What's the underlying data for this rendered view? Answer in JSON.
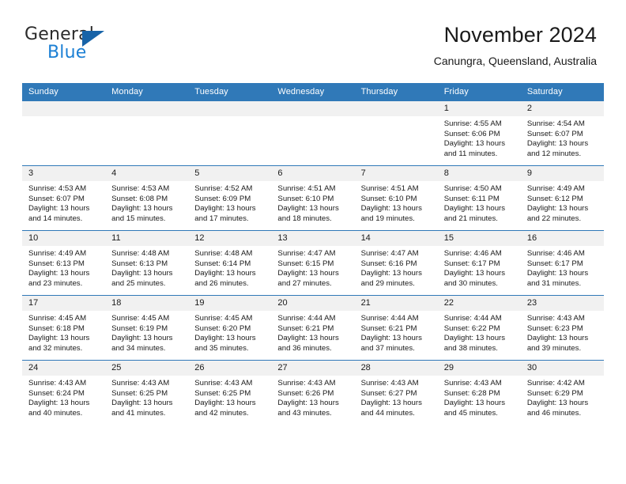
{
  "brand": {
    "name_top": "General",
    "name_bottom": "Blue",
    "triangle_color": "#1763a8",
    "blue_color": "#1b7fd4"
  },
  "header": {
    "title": "November 2024",
    "subtitle": "Canungra, Queensland, Australia"
  },
  "theme": {
    "header_blue": "#3079b8",
    "daynum_gray": "#f1f1f1",
    "text": "#1a1a1a"
  },
  "labels": {
    "sunrise_prefix": "Sunrise:",
    "sunset_prefix": "Sunset:",
    "daylight_prefix": "Daylight:"
  },
  "weekdays": [
    "Sunday",
    "Monday",
    "Tuesday",
    "Wednesday",
    "Thursday",
    "Friday",
    "Saturday"
  ],
  "weeks": [
    [
      {
        "day": "",
        "blank": true
      },
      {
        "day": "",
        "blank": true
      },
      {
        "day": "",
        "blank": true
      },
      {
        "day": "",
        "blank": true
      },
      {
        "day": "",
        "blank": true
      },
      {
        "day": "1",
        "sunrise": "Sunrise: 4:55 AM",
        "sunset": "Sunset: 6:06 PM",
        "daylight1": "Daylight: 13 hours",
        "daylight2": "and 11 minutes."
      },
      {
        "day": "2",
        "sunrise": "Sunrise: 4:54 AM",
        "sunset": "Sunset: 6:07 PM",
        "daylight1": "Daylight: 13 hours",
        "daylight2": "and 12 minutes."
      }
    ],
    [
      {
        "day": "3",
        "sunrise": "Sunrise: 4:53 AM",
        "sunset": "Sunset: 6:07 PM",
        "daylight1": "Daylight: 13 hours",
        "daylight2": "and 14 minutes."
      },
      {
        "day": "4",
        "sunrise": "Sunrise: 4:53 AM",
        "sunset": "Sunset: 6:08 PM",
        "daylight1": "Daylight: 13 hours",
        "daylight2": "and 15 minutes."
      },
      {
        "day": "5",
        "sunrise": "Sunrise: 4:52 AM",
        "sunset": "Sunset: 6:09 PM",
        "daylight1": "Daylight: 13 hours",
        "daylight2": "and 17 minutes."
      },
      {
        "day": "6",
        "sunrise": "Sunrise: 4:51 AM",
        "sunset": "Sunset: 6:10 PM",
        "daylight1": "Daylight: 13 hours",
        "daylight2": "and 18 minutes."
      },
      {
        "day": "7",
        "sunrise": "Sunrise: 4:51 AM",
        "sunset": "Sunset: 6:10 PM",
        "daylight1": "Daylight: 13 hours",
        "daylight2": "and 19 minutes."
      },
      {
        "day": "8",
        "sunrise": "Sunrise: 4:50 AM",
        "sunset": "Sunset: 6:11 PM",
        "daylight1": "Daylight: 13 hours",
        "daylight2": "and 21 minutes."
      },
      {
        "day": "9",
        "sunrise": "Sunrise: 4:49 AM",
        "sunset": "Sunset: 6:12 PM",
        "daylight1": "Daylight: 13 hours",
        "daylight2": "and 22 minutes."
      }
    ],
    [
      {
        "day": "10",
        "sunrise": "Sunrise: 4:49 AM",
        "sunset": "Sunset: 6:13 PM",
        "daylight1": "Daylight: 13 hours",
        "daylight2": "and 23 minutes."
      },
      {
        "day": "11",
        "sunrise": "Sunrise: 4:48 AM",
        "sunset": "Sunset: 6:13 PM",
        "daylight1": "Daylight: 13 hours",
        "daylight2": "and 25 minutes."
      },
      {
        "day": "12",
        "sunrise": "Sunrise: 4:48 AM",
        "sunset": "Sunset: 6:14 PM",
        "daylight1": "Daylight: 13 hours",
        "daylight2": "and 26 minutes."
      },
      {
        "day": "13",
        "sunrise": "Sunrise: 4:47 AM",
        "sunset": "Sunset: 6:15 PM",
        "daylight1": "Daylight: 13 hours",
        "daylight2": "and 27 minutes."
      },
      {
        "day": "14",
        "sunrise": "Sunrise: 4:47 AM",
        "sunset": "Sunset: 6:16 PM",
        "daylight1": "Daylight: 13 hours",
        "daylight2": "and 29 minutes."
      },
      {
        "day": "15",
        "sunrise": "Sunrise: 4:46 AM",
        "sunset": "Sunset: 6:17 PM",
        "daylight1": "Daylight: 13 hours",
        "daylight2": "and 30 minutes."
      },
      {
        "day": "16",
        "sunrise": "Sunrise: 4:46 AM",
        "sunset": "Sunset: 6:17 PM",
        "daylight1": "Daylight: 13 hours",
        "daylight2": "and 31 minutes."
      }
    ],
    [
      {
        "day": "17",
        "sunrise": "Sunrise: 4:45 AM",
        "sunset": "Sunset: 6:18 PM",
        "daylight1": "Daylight: 13 hours",
        "daylight2": "and 32 minutes."
      },
      {
        "day": "18",
        "sunrise": "Sunrise: 4:45 AM",
        "sunset": "Sunset: 6:19 PM",
        "daylight1": "Daylight: 13 hours",
        "daylight2": "and 34 minutes."
      },
      {
        "day": "19",
        "sunrise": "Sunrise: 4:45 AM",
        "sunset": "Sunset: 6:20 PM",
        "daylight1": "Daylight: 13 hours",
        "daylight2": "and 35 minutes."
      },
      {
        "day": "20",
        "sunrise": "Sunrise: 4:44 AM",
        "sunset": "Sunset: 6:21 PM",
        "daylight1": "Daylight: 13 hours",
        "daylight2": "and 36 minutes."
      },
      {
        "day": "21",
        "sunrise": "Sunrise: 4:44 AM",
        "sunset": "Sunset: 6:21 PM",
        "daylight1": "Daylight: 13 hours",
        "daylight2": "and 37 minutes."
      },
      {
        "day": "22",
        "sunrise": "Sunrise: 4:44 AM",
        "sunset": "Sunset: 6:22 PM",
        "daylight1": "Daylight: 13 hours",
        "daylight2": "and 38 minutes."
      },
      {
        "day": "23",
        "sunrise": "Sunrise: 4:43 AM",
        "sunset": "Sunset: 6:23 PM",
        "daylight1": "Daylight: 13 hours",
        "daylight2": "and 39 minutes."
      }
    ],
    [
      {
        "day": "24",
        "sunrise": "Sunrise: 4:43 AM",
        "sunset": "Sunset: 6:24 PM",
        "daylight1": "Daylight: 13 hours",
        "daylight2": "and 40 minutes."
      },
      {
        "day": "25",
        "sunrise": "Sunrise: 4:43 AM",
        "sunset": "Sunset: 6:25 PM",
        "daylight1": "Daylight: 13 hours",
        "daylight2": "and 41 minutes."
      },
      {
        "day": "26",
        "sunrise": "Sunrise: 4:43 AM",
        "sunset": "Sunset: 6:25 PM",
        "daylight1": "Daylight: 13 hours",
        "daylight2": "and 42 minutes."
      },
      {
        "day": "27",
        "sunrise": "Sunrise: 4:43 AM",
        "sunset": "Sunset: 6:26 PM",
        "daylight1": "Daylight: 13 hours",
        "daylight2": "and 43 minutes."
      },
      {
        "day": "28",
        "sunrise": "Sunrise: 4:43 AM",
        "sunset": "Sunset: 6:27 PM",
        "daylight1": "Daylight: 13 hours",
        "daylight2": "and 44 minutes."
      },
      {
        "day": "29",
        "sunrise": "Sunrise: 4:43 AM",
        "sunset": "Sunset: 6:28 PM",
        "daylight1": "Daylight: 13 hours",
        "daylight2": "and 45 minutes."
      },
      {
        "day": "30",
        "sunrise": "Sunrise: 4:42 AM",
        "sunset": "Sunset: 6:29 PM",
        "daylight1": "Daylight: 13 hours",
        "daylight2": "and 46 minutes."
      }
    ]
  ]
}
